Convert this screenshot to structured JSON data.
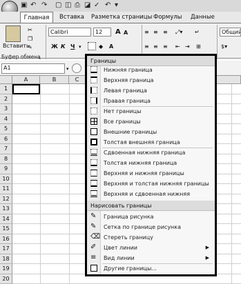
{
  "tabs": [
    "Главная",
    "Вставка",
    "Разметка страницы",
    "Формулы",
    "Данные"
  ],
  "ribbon": {
    "paste_label": "Вставить",
    "font_name": "Calibri",
    "font_size": "12",
    "bold": "Ж",
    "italic": "К",
    "underline": "Ч",
    "grow_font": "A",
    "shrink_font": "A",
    "number_format": "Общий",
    "clipboard_group": "Буфер обмена"
  },
  "formula_bar": {
    "cell_ref": "A1"
  },
  "grid": {
    "columns": [
      "A",
      "B",
      "C"
    ],
    "rows": [
      "1",
      "2",
      "3",
      "4",
      "5",
      "6",
      "7",
      "8",
      "9",
      "10",
      "11",
      "12",
      "13",
      "14",
      "15",
      "16",
      "17",
      "18",
      "19",
      "20"
    ]
  },
  "menu": {
    "header_borders": "Границы",
    "header_draw": "Нарисовать границы",
    "borders": [
      {
        "label": "Нижняя граница",
        "icon": "border-bottom-icon"
      },
      {
        "label": "Верхняя граница",
        "icon": "border-top-icon"
      },
      {
        "label": "Левая граница",
        "icon": "border-left-icon"
      },
      {
        "label": "Правая граница",
        "icon": "border-right-icon"
      },
      {
        "label": "Нет границы",
        "icon": "border-none-icon"
      },
      {
        "label": "Все границы",
        "icon": "border-all-icon"
      },
      {
        "label": "Внешние границы",
        "icon": "border-outside-icon"
      },
      {
        "label": "Толстая внешняя граница",
        "icon": "border-thick-outside-icon"
      },
      {
        "label": "Сдвоенная нижняя граница",
        "icon": "border-double-bottom-icon"
      },
      {
        "label": "Толстая нижняя граница",
        "icon": "border-thick-bottom-icon"
      },
      {
        "label": "Верхняя и нижняя границы",
        "icon": "border-top-bottom-icon"
      },
      {
        "label": "Верхняя и толстая нижняя границы",
        "icon": "border-top-thick-bottom-icon"
      },
      {
        "label": "Верхняя и сдвоенная нижняя границы",
        "icon": "border-top-double-bottom-icon"
      }
    ],
    "draw": [
      {
        "label": "Граница рисунка",
        "icon": "pencil-icon"
      },
      {
        "label": "Сетка по границе рисунка",
        "icon": "grid-pencil-icon"
      },
      {
        "label": "Стереть границу",
        "icon": "eraser-icon"
      },
      {
        "label": "Цвет линии",
        "icon": "line-color-icon",
        "submenu": true
      },
      {
        "label": "Вид линии",
        "icon": "line-style-icon",
        "submenu": true
      },
      {
        "label": "Другие границы...",
        "icon": "more-borders-icon"
      }
    ]
  }
}
